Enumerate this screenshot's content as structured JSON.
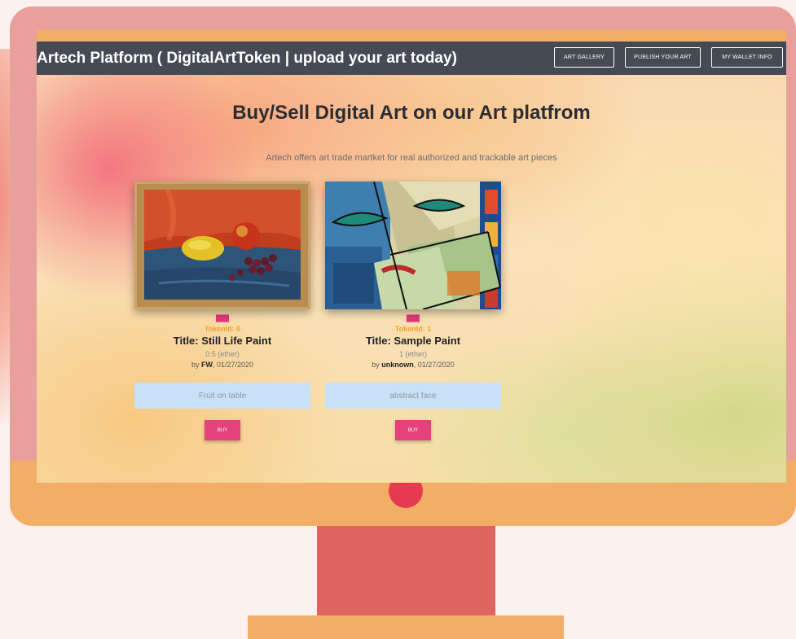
{
  "navbar": {
    "brand": "Artech Platform ( DigitalArtToken | upload your art today)",
    "buttons": [
      {
        "label": "ART GALLERY"
      },
      {
        "label": "PUBLISH YOUR ART"
      },
      {
        "label": "MY WALLET INFO"
      }
    ]
  },
  "hero": {
    "title": "Buy/Sell Digital Art on our Art platfrom",
    "subtitle": "Artech offers art trade martket for real authorized and trackable art pieces"
  },
  "artworks": [
    {
      "token_id": "TokenId: 0",
      "title": "Title: Still Life Paint",
      "price": "0.5 (ether)",
      "by_prefix": "by",
      "author": "FW",
      "date": ", 01/27/2020",
      "description": "Fruit on table",
      "buy_label": "BUY"
    },
    {
      "token_id": "TokenId: 1",
      "title": "Title: Sample Paint",
      "price": "1 (ether)",
      "by_prefix": "by",
      "author": "unknown",
      "date": ", 01/27/2020",
      "description": "abstract face",
      "buy_label": "BUY"
    }
  ],
  "icons": {
    "token": "palette-icon"
  },
  "colors": {
    "navbar": "#454a55",
    "buy_button": "#e5417a",
    "token_id": "#f0a12c",
    "description_box": "#c9e1f6",
    "monitor_frame": "#e8a09c",
    "monitor_chin": "#f2ae67",
    "power_button": "#e53a4f"
  }
}
